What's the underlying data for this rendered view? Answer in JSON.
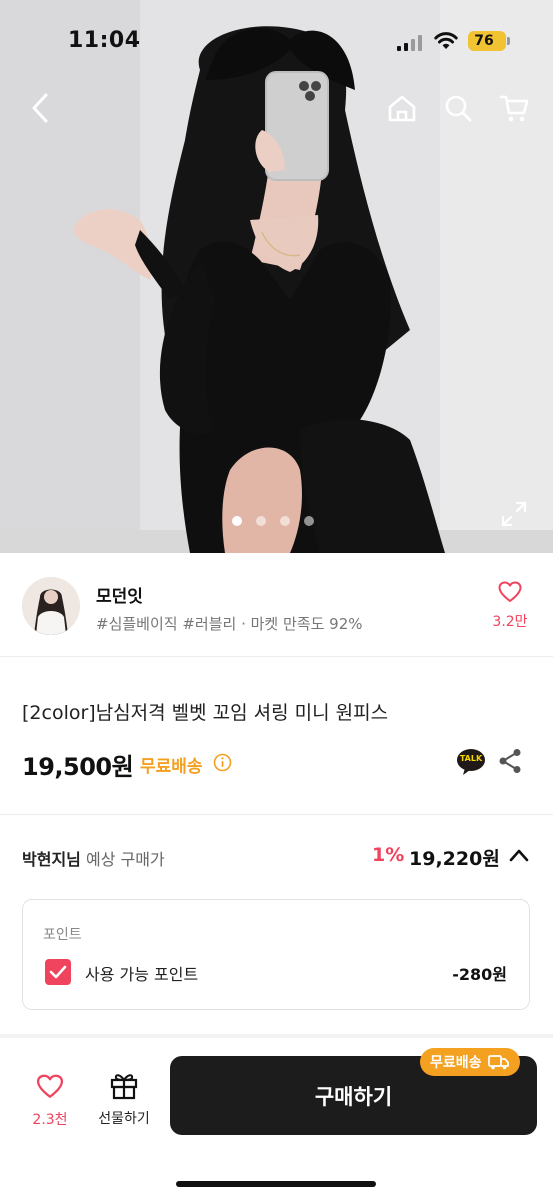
{
  "status_bar": {
    "time": "11:04",
    "battery": "76"
  },
  "hero": {
    "image_count": 4,
    "active_index": 0
  },
  "nav": {
    "back_icon": "chevron-left-icon",
    "home_icon": "home-icon",
    "search_icon": "search-icon",
    "cart_icon": "cart-icon"
  },
  "seller": {
    "name": "모던잇",
    "tags": "#심플베이직 #러블리 · 마켓 만족도 92%",
    "likes": "3.2만"
  },
  "product": {
    "title": "[2color]남심저격 벨벳 꼬임 셔링 미니 원피스",
    "price": "19,500원",
    "shipping": "무료배송",
    "talk_label": "TALK"
  },
  "expected": {
    "user": "박현지님",
    "label": "예상 구매가",
    "rate": "1%",
    "price": "19,220원"
  },
  "points": {
    "header": "포인트",
    "item_label": "사용 가능 포인트",
    "item_value": "-280원",
    "checked": true
  },
  "bottom_bar": {
    "wish_count": "2.3천",
    "gift_label": "선물하기",
    "buy_label": "구매하기",
    "ship_badge": "무료배송"
  },
  "colors": {
    "accent_red": "#f0435d",
    "accent_orange": "#f4a021",
    "buy_button": "#1c1c1c",
    "battery": "#f1c232"
  }
}
